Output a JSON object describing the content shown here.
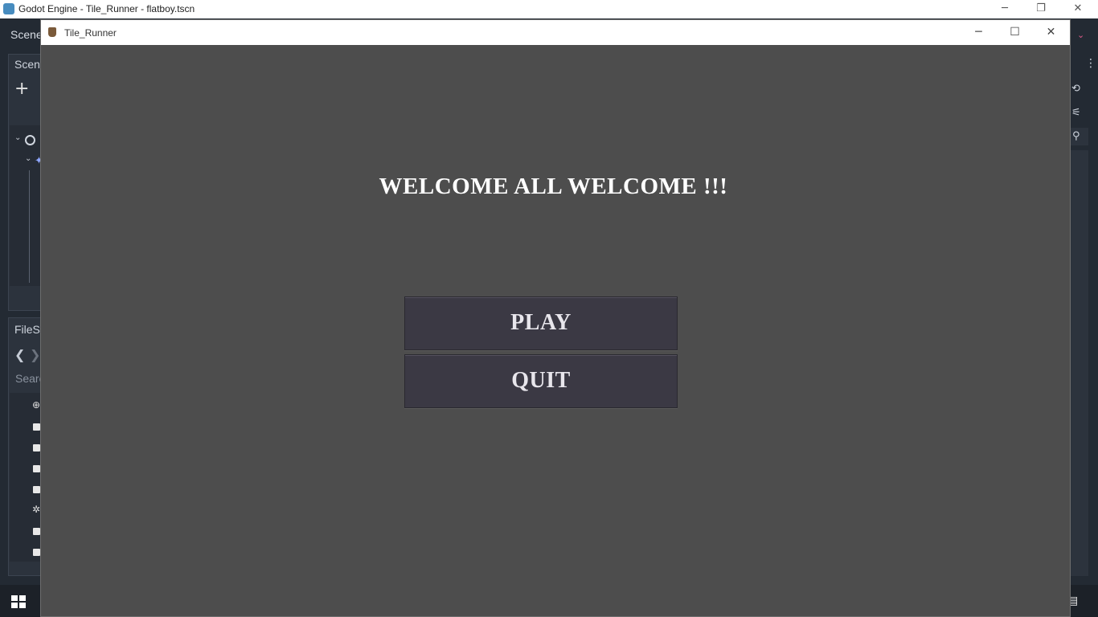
{
  "editor": {
    "window_title": "Godot Engine - Tile_Runner - flatboy.tscn",
    "minimize": "─",
    "restore": "❐",
    "close": "✕",
    "menu_scene": "Scene",
    "scene_dock_title": "Scen",
    "filesystem_dock_title": "FileSy",
    "filesystem_search_placeholder": "Searc",
    "add_node": "+",
    "nav_back": "❮",
    "nav_forward": "❯"
  },
  "game": {
    "window_title": "Tile_Runner",
    "minimize": "─",
    "maximize": "☐",
    "close": "✕",
    "welcome_text": "WELCOME ALL WELCOME !!!",
    "play_label": "PLAY",
    "quit_label": "QUIT"
  },
  "colors": {
    "game_background": "#4d4d4d",
    "button_background": "#3b3944",
    "editor_background": "#232a33"
  }
}
